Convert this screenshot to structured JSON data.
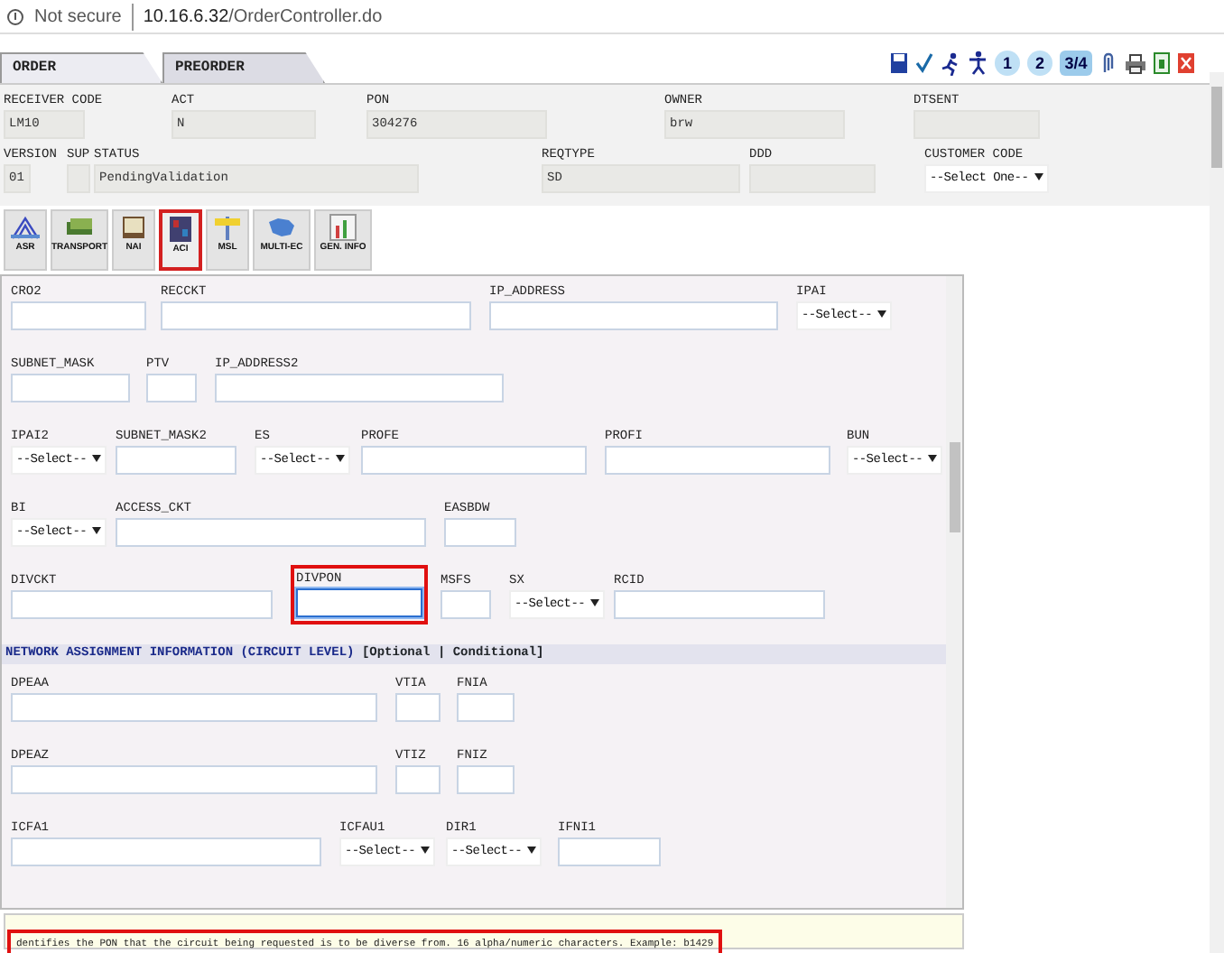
{
  "address_bar": {
    "security": "Not secure",
    "url_host": "10.16.6.32",
    "url_path": "/OrderController.do"
  },
  "tabs": [
    {
      "label": "ORDER",
      "selected": true
    },
    {
      "label": "PREORDER",
      "selected": false
    }
  ],
  "toolbar": {
    "steps": [
      {
        "label": "1",
        "selected": false
      },
      {
        "label": "2",
        "selected": false
      },
      {
        "label": "3/4",
        "selected": true
      }
    ]
  },
  "header": {
    "top_line": [
      {
        "label": "RECEIVER CODE",
        "value": "LM10",
        "kind": "text"
      },
      {
        "label": "ACT",
        "value": "N",
        "kind": "text"
      },
      {
        "label": "PON",
        "value": "304276",
        "kind": "text"
      },
      {
        "label": "OWNER",
        "value": "brw",
        "kind": "text"
      },
      {
        "label": "DTSENT",
        "kind": "text"
      }
    ],
    "bottom_line": [
      {
        "label": "VERSION",
        "value": "01",
        "kind": "text"
      },
      {
        "label": "SUP",
        "kind": "text"
      },
      {
        "label": "STATUS",
        "value": "PendingValidation",
        "kind": "text"
      },
      {
        "label": "REQTYPE",
        "value": "SD",
        "kind": "text"
      },
      {
        "label": "DDD",
        "kind": "text"
      },
      {
        "label": "CUSTOMER CODE",
        "value": "--Select One--",
        "kind": "select"
      }
    ]
  },
  "sections": [
    {
      "label": "ASR",
      "selected": false
    },
    {
      "label": "TRANSPORT",
      "selected": false
    },
    {
      "label": "NAI",
      "selected": false
    },
    {
      "label": "ACI",
      "selected": true
    },
    {
      "label": "MSL",
      "selected": false
    },
    {
      "label": "MULTI-EC",
      "selected": false
    },
    {
      "label": "GEN. INFO",
      "selected": false
    }
  ],
  "form": {
    "rows": [
      [
        {
          "label": "CRO2",
          "kind": "text"
        },
        {
          "label": "RECCKT",
          "kind": "text"
        },
        {
          "label": "IP_ADDRESS",
          "kind": "text"
        },
        {
          "label": "IPAI",
          "kind": "select",
          "value": "--Select--"
        }
      ],
      [
        {
          "label": "SUBNET_MASK",
          "kind": "text"
        },
        {
          "label": "PTV",
          "kind": "text"
        },
        {
          "label": "IP_ADDRESS2",
          "kind": "text"
        }
      ],
      [
        {
          "label": "IPAI2",
          "kind": "select",
          "value": "--Select--"
        },
        {
          "label": "SUBNET_MASK2",
          "kind": "text"
        },
        {
          "label": "ES",
          "kind": "select",
          "value": "--Select--"
        },
        {
          "label": "PROFE",
          "kind": "text"
        },
        {
          "label": "PROFI",
          "kind": "text"
        },
        {
          "label": "BUN",
          "kind": "select",
          "value": "--Select--"
        }
      ],
      [
        {
          "label": "BI",
          "kind": "select",
          "value": "--Select--"
        },
        {
          "label": "ACCESS_CKT",
          "kind": "text"
        },
        {
          "label": "EASBDW",
          "kind": "text"
        }
      ],
      [
        {
          "label": "DIVCKT",
          "kind": "text"
        },
        {
          "label": "DIVPON",
          "kind": "text",
          "highlighted": true,
          "focused": true
        },
        {
          "label": "MSFS",
          "kind": "text"
        },
        {
          "label": "SX",
          "kind": "select",
          "value": "--Select--"
        },
        {
          "label": "RCID",
          "kind": "text"
        }
      ]
    ],
    "section_header": {
      "title": "NETWORK ASSIGNMENT INFORMATION (CIRCUIT LEVEL)",
      "options": "[Optional | Conditional]"
    },
    "rows2": [
      [
        {
          "label": "DPEAA",
          "kind": "text"
        },
        {
          "label": "VTIA",
          "kind": "text"
        },
        {
          "label": "FNIA",
          "kind": "text"
        }
      ],
      [
        {
          "label": "DPEAZ",
          "kind": "text"
        },
        {
          "label": "VTIZ",
          "kind": "text"
        },
        {
          "label": "FNIZ",
          "kind": "text"
        }
      ],
      [
        {
          "label": "ICFA1",
          "kind": "text"
        },
        {
          "label": "ICFAU1",
          "kind": "select",
          "value": "--Select--"
        },
        {
          "label": "DIR1",
          "kind": "select",
          "value": "--Select--"
        },
        {
          "label": "IFNI1",
          "kind": "text"
        }
      ]
    ]
  },
  "help": {
    "text": "dentifies the PON that the circuit being requested is to be diverse from. 16 alpha/numeric characters. Example: b1429",
    "highlighted": true
  }
}
